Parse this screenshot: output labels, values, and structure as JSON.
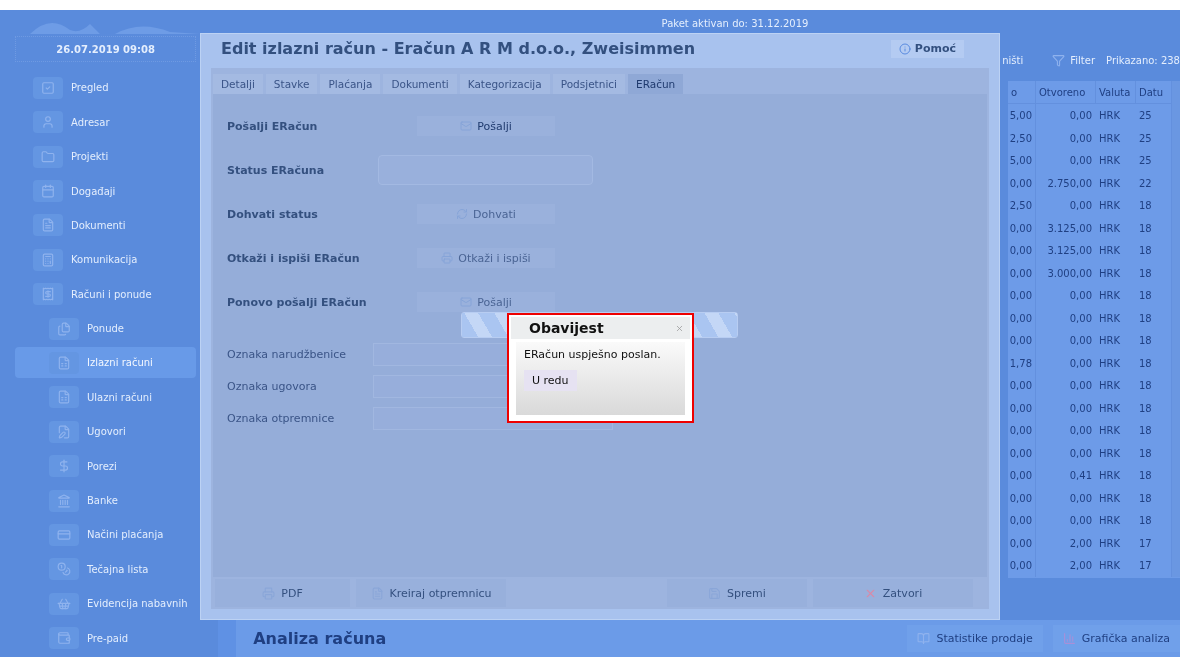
{
  "top_bar": {
    "package_notice": "Paket aktivan do: 31.12.2019"
  },
  "sidebar": {
    "datetime": "26.07.2019 09:08",
    "items": [
      {
        "label": "Pregled",
        "selected": false
      },
      {
        "label": "Adresar",
        "selected": false
      },
      {
        "label": "Projekti",
        "selected": false
      },
      {
        "label": "Događaji",
        "selected": false
      },
      {
        "label": "Dokumenti",
        "selected": false
      },
      {
        "label": "Komunikacija",
        "selected": false
      },
      {
        "label": "Računi i ponude",
        "selected": false,
        "children": [
          {
            "label": "Ponude",
            "selected": false
          },
          {
            "label": "Izlazni računi",
            "selected": true
          },
          {
            "label": "Ulazni računi",
            "selected": false
          },
          {
            "label": "Ugovori",
            "selected": false
          },
          {
            "label": "Porezi",
            "selected": false
          },
          {
            "label": "Banke",
            "selected": false
          },
          {
            "label": "Načini plaćanja",
            "selected": false
          },
          {
            "label": "Tečajna lista",
            "selected": false
          },
          {
            "label": "Evidencija nabavnih",
            "selected": false
          },
          {
            "label": "Pre-paid",
            "selected": false
          }
        ]
      }
    ]
  },
  "table": {
    "toolbar": [
      "ništi",
      "Filter"
    ],
    "count": "Prikazano: 238",
    "columns": [
      "o",
      "Otvoreno",
      "Valuta",
      "Datu"
    ],
    "rows": [
      [
        "5,00",
        "0,00",
        "HRK",
        "25"
      ],
      [
        "2,50",
        "0,00",
        "HRK",
        "25"
      ],
      [
        "5,00",
        "0,00",
        "HRK",
        "25"
      ],
      [
        "0,00",
        "2.750,00",
        "HRK",
        "22"
      ],
      [
        "2,50",
        "0,00",
        "HRK",
        "18"
      ],
      [
        "0,00",
        "3.125,00",
        "HRK",
        "18"
      ],
      [
        "0,00",
        "3.125,00",
        "HRK",
        "18"
      ],
      [
        "0,00",
        "3.000,00",
        "HRK",
        "18"
      ],
      [
        "0,00",
        "0,00",
        "HRK",
        "18"
      ],
      [
        "0,00",
        "0,00",
        "HRK",
        "18"
      ],
      [
        "0,00",
        "0,00",
        "HRK",
        "18"
      ],
      [
        "1,78",
        "0,00",
        "HRK",
        "18"
      ],
      [
        "0,00",
        "0,00",
        "HRK",
        "18"
      ],
      [
        "0,00",
        "0,00",
        "HRK",
        "18"
      ],
      [
        "0,00",
        "0,00",
        "HRK",
        "18"
      ],
      [
        "0,00",
        "0,00",
        "HRK",
        "18"
      ],
      [
        "0,00",
        "0,41",
        "HRK",
        "18"
      ],
      [
        "0,00",
        "0,00",
        "HRK",
        "18"
      ],
      [
        "0,00",
        "0,00",
        "HRK",
        "18"
      ],
      [
        "0,00",
        "2,00",
        "HRK",
        "17"
      ],
      [
        "0,00",
        "2,00",
        "HRK",
        "17"
      ]
    ]
  },
  "analysis": {
    "title": "Analiza računa",
    "buttons": [
      "Statistike prodaje",
      "Grafička analiza"
    ]
  },
  "dialog": {
    "title": "Edit izlazni račun - Eračun A R M d.o.o., Zweisimmen",
    "help_button": "Pomoć",
    "tabs": [
      {
        "label": "Detalji",
        "selected": false
      },
      {
        "label": "Stavke",
        "selected": false
      },
      {
        "label": "Plaćanja",
        "selected": false
      },
      {
        "label": "Dokumenti",
        "selected": false
      },
      {
        "label": "Kategorizacija",
        "selected": false
      },
      {
        "label": "Podsjetnici",
        "selected": false
      },
      {
        "label": "ERačun",
        "selected": true
      }
    ],
    "actions": [
      {
        "kind": "button",
        "label": "Pošalji ERačun",
        "button": "Pošalji",
        "disabled": false
      },
      {
        "kind": "field",
        "label": "Status ERačuna"
      },
      {
        "kind": "button",
        "label": "Dohvati status",
        "button": "Dohvati",
        "disabled": true
      },
      {
        "kind": "button",
        "label": "Otkaži i ispiši ERačun",
        "button": "Otkaži i ispiši",
        "disabled": true
      },
      {
        "kind": "button",
        "label": "Ponovo pošalji ERačun",
        "button": "Pošalji",
        "disabled": true
      }
    ],
    "fields": [
      {
        "label": "Oznaka narudžbenice"
      },
      {
        "label": "Oznaka ugovora"
      },
      {
        "label": "Oznaka otpremnice"
      }
    ],
    "footer_buttons": [
      "PDF",
      "Kreiraj otpremnicu",
      "Spremi",
      "Zatvori"
    ]
  },
  "progress": {
    "level": 1
  },
  "alert": {
    "title": "Obavijest",
    "message": "ERačun uspješno poslan.",
    "button": "U redu"
  }
}
